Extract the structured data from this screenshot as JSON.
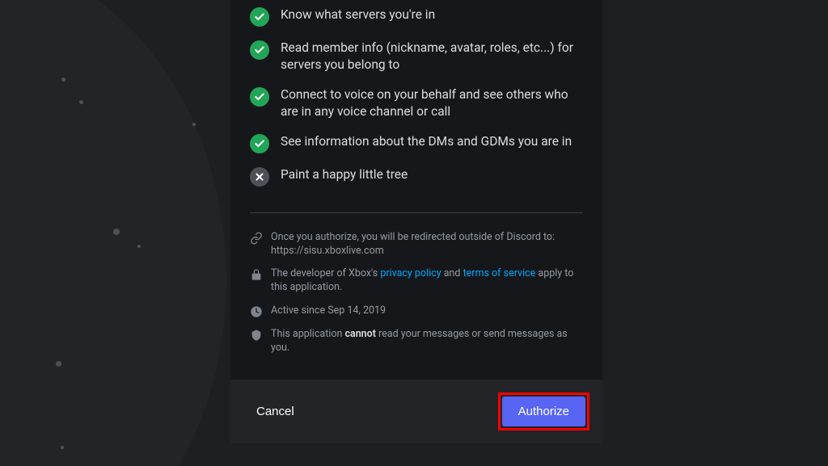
{
  "permissions": [
    {
      "type": "allow",
      "text": "Know what servers you're in"
    },
    {
      "type": "allow",
      "text": "Read member info (nickname, avatar, roles, etc...) for servers you belong to"
    },
    {
      "type": "allow",
      "text": "Connect to voice on your behalf and see others who are in any voice channel or call"
    },
    {
      "type": "allow",
      "text": "See information about the DMs and GDMs you are in"
    },
    {
      "type": "deny",
      "text": "Paint a happy little tree"
    }
  ],
  "info": {
    "redirect_prefix": "Once you authorize, you will be redirected outside of Discord to: ",
    "redirect_target": "https://sisu.xboxlive.com",
    "dev_prefix": "The developer of Xbox's ",
    "privacy_link": "privacy policy",
    "dev_and": " and ",
    "tos_link": "terms of service",
    "dev_suffix": " apply to this application.",
    "active_since": "Active since Sep 14, 2019",
    "cannot_prefix": "This application ",
    "cannot_word": "cannot",
    "cannot_suffix": " read your messages or send messages as you."
  },
  "footer": {
    "cancel": "Cancel",
    "authorize": "Authorize"
  }
}
